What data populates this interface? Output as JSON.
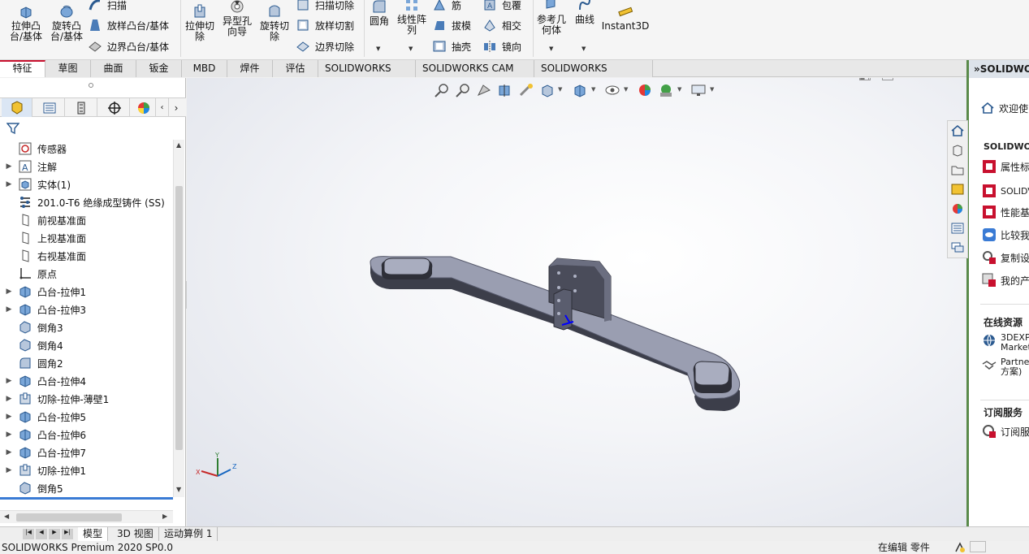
{
  "ribbon": {
    "extrude_boss": "拉伸凸\n台/基体",
    "revolve_boss": "旋转凸\n台/基体",
    "sweep": "扫描",
    "loft_boss": "放样凸台/基体",
    "boundary_boss": "边界凸台/基体",
    "extrude_cut": "拉伸切\n除",
    "hole_wizard": "异型孔\n向导",
    "revolve_cut": "旋转切\n除",
    "swept_cut": "扫描切除",
    "lofted_cut": "放样切割",
    "boundary_cut": "边界切除",
    "fillet": "圆角",
    "linear_pattern": "线性阵\n列",
    "rib": "筋",
    "draft": "拔模",
    "shell": "抽壳",
    "wrap": "包覆",
    "intersect": "相交",
    "mirror": "镜向",
    "ref_geometry": "参考几\n何体",
    "curves": "曲线",
    "instant3d": "Instant3D"
  },
  "command_tabs": [
    "特征",
    "草图",
    "曲面",
    "钣金",
    "MBD",
    "焊件(D)",
    "评估",
    "SOLIDWORKS CAM",
    "SOLIDWORKS CAM TBM",
    "SOLIDWORKS Inspection"
  ],
  "tree": {
    "items": [
      {
        "label": "传感器",
        "expandable": false,
        "icon": "sensor-icon"
      },
      {
        "label": "注解",
        "expandable": true,
        "icon": "annotation-icon"
      },
      {
        "label": "实体(1)",
        "expandable": true,
        "icon": "solid-bodies-icon"
      },
      {
        "label": "201.0-T6 绝缘成型铸件 (SS)",
        "expandable": false,
        "icon": "material-icon"
      },
      {
        "label": "前视基准面",
        "expandable": false,
        "icon": "plane-icon"
      },
      {
        "label": "上视基准面",
        "expandable": false,
        "icon": "plane-icon"
      },
      {
        "label": "右视基准面",
        "expandable": false,
        "icon": "plane-icon"
      },
      {
        "label": "原点",
        "expandable": false,
        "icon": "origin-icon"
      },
      {
        "label": "凸台-拉伸1",
        "expandable": true,
        "icon": "extrude-icon"
      },
      {
        "label": "凸台-拉伸3",
        "expandable": true,
        "icon": "extrude-icon"
      },
      {
        "label": "倒角3",
        "expandable": false,
        "icon": "chamfer-icon"
      },
      {
        "label": "倒角4",
        "expandable": false,
        "icon": "chamfer-icon"
      },
      {
        "label": "圆角2",
        "expandable": false,
        "icon": "fillet-icon"
      },
      {
        "label": "凸台-拉伸4",
        "expandable": true,
        "icon": "extrude-icon"
      },
      {
        "label": "切除-拉伸-薄壁1",
        "expandable": true,
        "icon": "cut-icon"
      },
      {
        "label": "凸台-拉伸5",
        "expandable": true,
        "icon": "extrude-icon"
      },
      {
        "label": "凸台-拉伸6",
        "expandable": true,
        "icon": "extrude-icon"
      },
      {
        "label": "凸台-拉伸7",
        "expandable": true,
        "icon": "extrude-icon"
      },
      {
        "label": "切除-拉伸1",
        "expandable": true,
        "icon": "cut-icon"
      },
      {
        "label": "倒角5",
        "expandable": false,
        "icon": "chamfer-icon"
      }
    ]
  },
  "right_pane": {
    "header": "SOLIDWORKS",
    "welcome": "欢迎使",
    "section_solidworks": "SOLIDWOR",
    "items": [
      "属性标",
      "SOLIDV",
      "性能基",
      "比较我",
      "复制设",
      "我的产"
    ],
    "section_online": "在线资源",
    "online_items": [
      "3DEXP\nMarket",
      "Partne\n方案)"
    ],
    "section_subscribe": "订阅服务",
    "subscribe_item": "订阅服"
  },
  "bottom_tabs": [
    "模型",
    "3D 视图",
    "运动算例 1"
  ],
  "status": {
    "left": "SOLIDWORKS Premium 2020 SP0.0",
    "right": "在编辑 零件"
  },
  "colors": {
    "accent_red": "#c8102e",
    "part_top": "#9a9eb1",
    "part_side": "#3c3e4a",
    "task_pane_border": "#5a8a4a"
  }
}
